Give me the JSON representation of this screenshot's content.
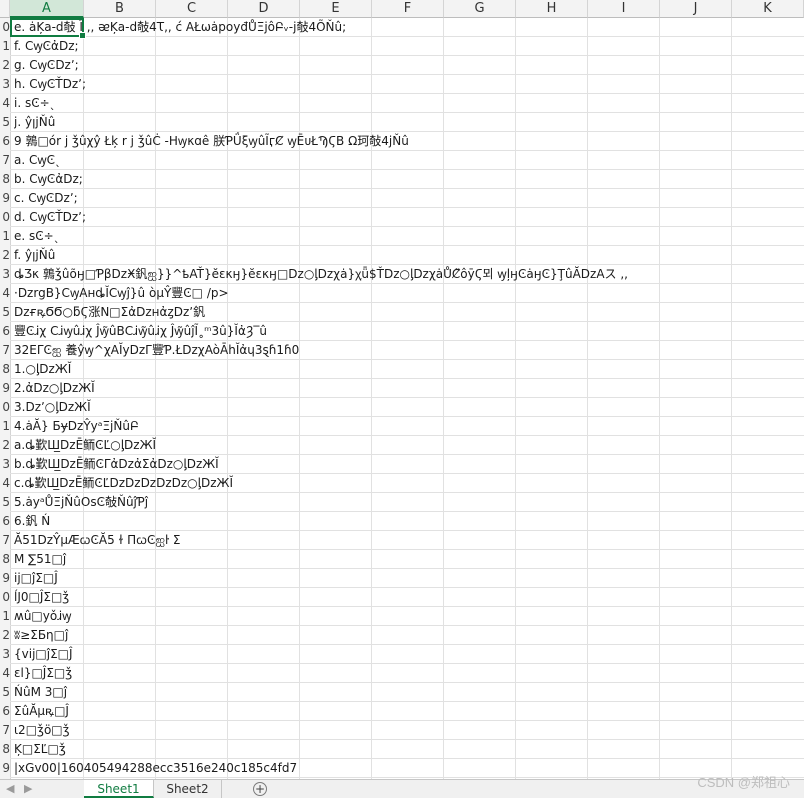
{
  "columns": [
    "A",
    "B",
    "C",
    "D",
    "E",
    "F",
    "G",
    "H",
    "I",
    "J",
    "K"
  ],
  "row_numbers": [
    "0",
    "1",
    "2",
    "3",
    "4",
    "5",
    "6",
    "7",
    "8",
    "9",
    "0",
    "1",
    "2",
    "3",
    "4",
    "5",
    "6",
    "7",
    "8",
    "9",
    "0",
    "1",
    "2",
    "3",
    "4",
    "5",
    "6",
    "7",
    "8",
    "9",
    "0",
    "1",
    "2",
    "3",
    "4",
    "5",
    "6",
    "7",
    "8",
    "9"
  ],
  "cells": [
    "e. ȧĶa-d敧 Ï ,, ᴂĶa-d敧4Ꚍ,, ć AŁωȧpoyđŮΞjôԲᵥ-j敧4ÕŇû;",
    "f. CꝡϾἀDz;",
    "g. CꝡϾDzʼ;",
    "h. CꝡϾŤDzʼ;",
    "i. ѕϾ÷ˎ",
    "j. ŷꞁjŇû",
    "9 鶉□ór j ǯûχŷ Łķ r j ǯûĊ -Hꝡκɑê 朕ƤǗξꝡûĨӷȻ ꝡĒᴜŁϠϚB Ω珂敧4jŇû",
    "a. CꝡϾˎ",
    "b. CꝡϾἀDz;",
    "c. CꝡϾDzʼ;",
    "d. CꝡϾŤDzʼ;",
    "e. ѕϾ÷ˎ",
    "f. ŷꞁjŇû",
    "ȡƷκ 鶉ǯûõӈ□ƤβDzӾ釩ஐ}}^ҍAŤ}ĕεκӈ}ĕεκӈ□Dz○ᶅDzχȧ}χ᷊ǖ$ŤDz○ᶅDzχȧŮȻ̃ôȳϚ뫼 ꝡļӈϾȧӈϾ}ŢûĂDzAス ,,",
    "·DzrgB}CꝡAʜȡĬCꝡĵ}û òµŶ豐Ͼ□ /p>",
    "DzғꝶϬϬ○ƃϚ涨Ν□ΣἀDzʜἀȥDzʼ釩",
    "豐Ͼɹ̇χ Ϲɹ̇ꝡûɹ̇χ Ĵꝡ̃ûBϹɹ̇ꝡ̃ûɹ̇χ Ĵꝡ̃ûĵĨ˳ᵐ3û}ĬἀȜ‾û",
    "32EΓϾஐ 養ŷꝡ^χAĬyDzΓ豐Ƥ.ŁDzχAòĀhĬἀɥ3ȿɦ1ɦ0",
    "1.○ᶅDzЖĬ",
    "2.ἀDz○ᶅDzЖĬ",
    "3.Dzʼ○ᶅDzЖĬ",
    "4.ȧĂ} ƂɏDzŶyᵃΞjŇûԲ",
    "a.ȡ歏Ш̲DzĒ鲕ϾĽ○ᶅDzЖĬ",
    "b.ȡ歏Ш̲DzĒ鲕ϾΓἀDzἀΣἀDz○ᶅDzЖĬ",
    "c.ȡ歏Ш̲DzĒ鲕ϾĽDzDzDzDzDz○ᶅDzЖĬ",
    "5.ȧyᵃŮΞjŇûOѕϾ敧ŇûĵƤĵ",
    "6.釩 Ń",
    "Ă51DzŶµÆꞷϾĂ5 ɫ ΠꞷϾஐŀ Σ",
    "Ⅿ ∑51□ĵ",
    " ij□ĵΣ□Ĵ",
    "ĺJ0□ĴΣ□ǯ",
    "ʍû□yǒɹ̇ꝡ",
    "ʬ≥ΣƂη□ĵ",
    "{vij□ĵΣ□Ĵ",
    "ɛl}□ĴΣ□ǯ",
    "ŃûM 3□ĵ",
    "ΣûĂµꝶ□Ĵ",
    "ɩ2□ǯö□ǯ",
    "Ķ□ΣĽ□ǯ",
    "|xGv00|160405494288ecc3516e240c185c4fd7"
  ],
  "tabs": [
    "Sheet1",
    "Sheet2"
  ],
  "watermark": "CSDN @郑祖心"
}
